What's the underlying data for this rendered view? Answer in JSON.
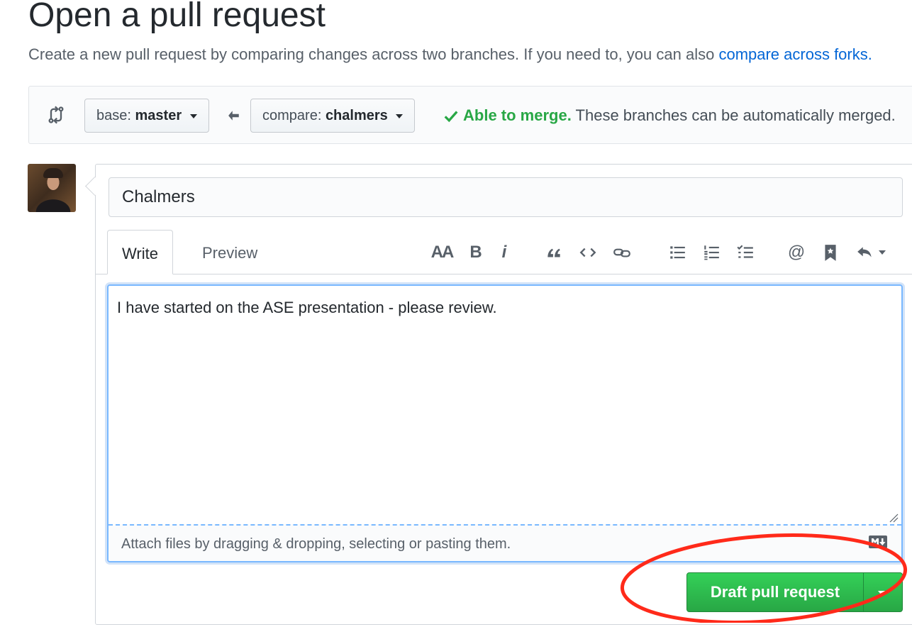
{
  "header": {
    "title": "Open a pull request",
    "subtitle": "Create a new pull request by comparing changes across two branches. If you need to, you can also ",
    "subtitle_link": "compare across forks."
  },
  "range": {
    "base_label": "base:",
    "base_value": "master",
    "compare_label": "compare:",
    "compare_value": "chalmers",
    "merge_ok": "Able to merge.",
    "merge_msg": "These branches can be automatically merged."
  },
  "form": {
    "title_value": "Chalmers",
    "tabs": {
      "write": "Write",
      "preview": "Preview"
    },
    "toolbar": {
      "header": "AA",
      "bold": "B",
      "italic": "i",
      "mention": "@"
    },
    "body_value": "I have started on the ASE presentation - please review.",
    "attach_hint": "Attach files by dragging & dropping, selecting or pasting them.",
    "submit_label": "Draft pull request"
  },
  "colors": {
    "accent_green": "#28a745",
    "link_blue": "#0366d6",
    "annotation_red": "#ff2a1a"
  }
}
